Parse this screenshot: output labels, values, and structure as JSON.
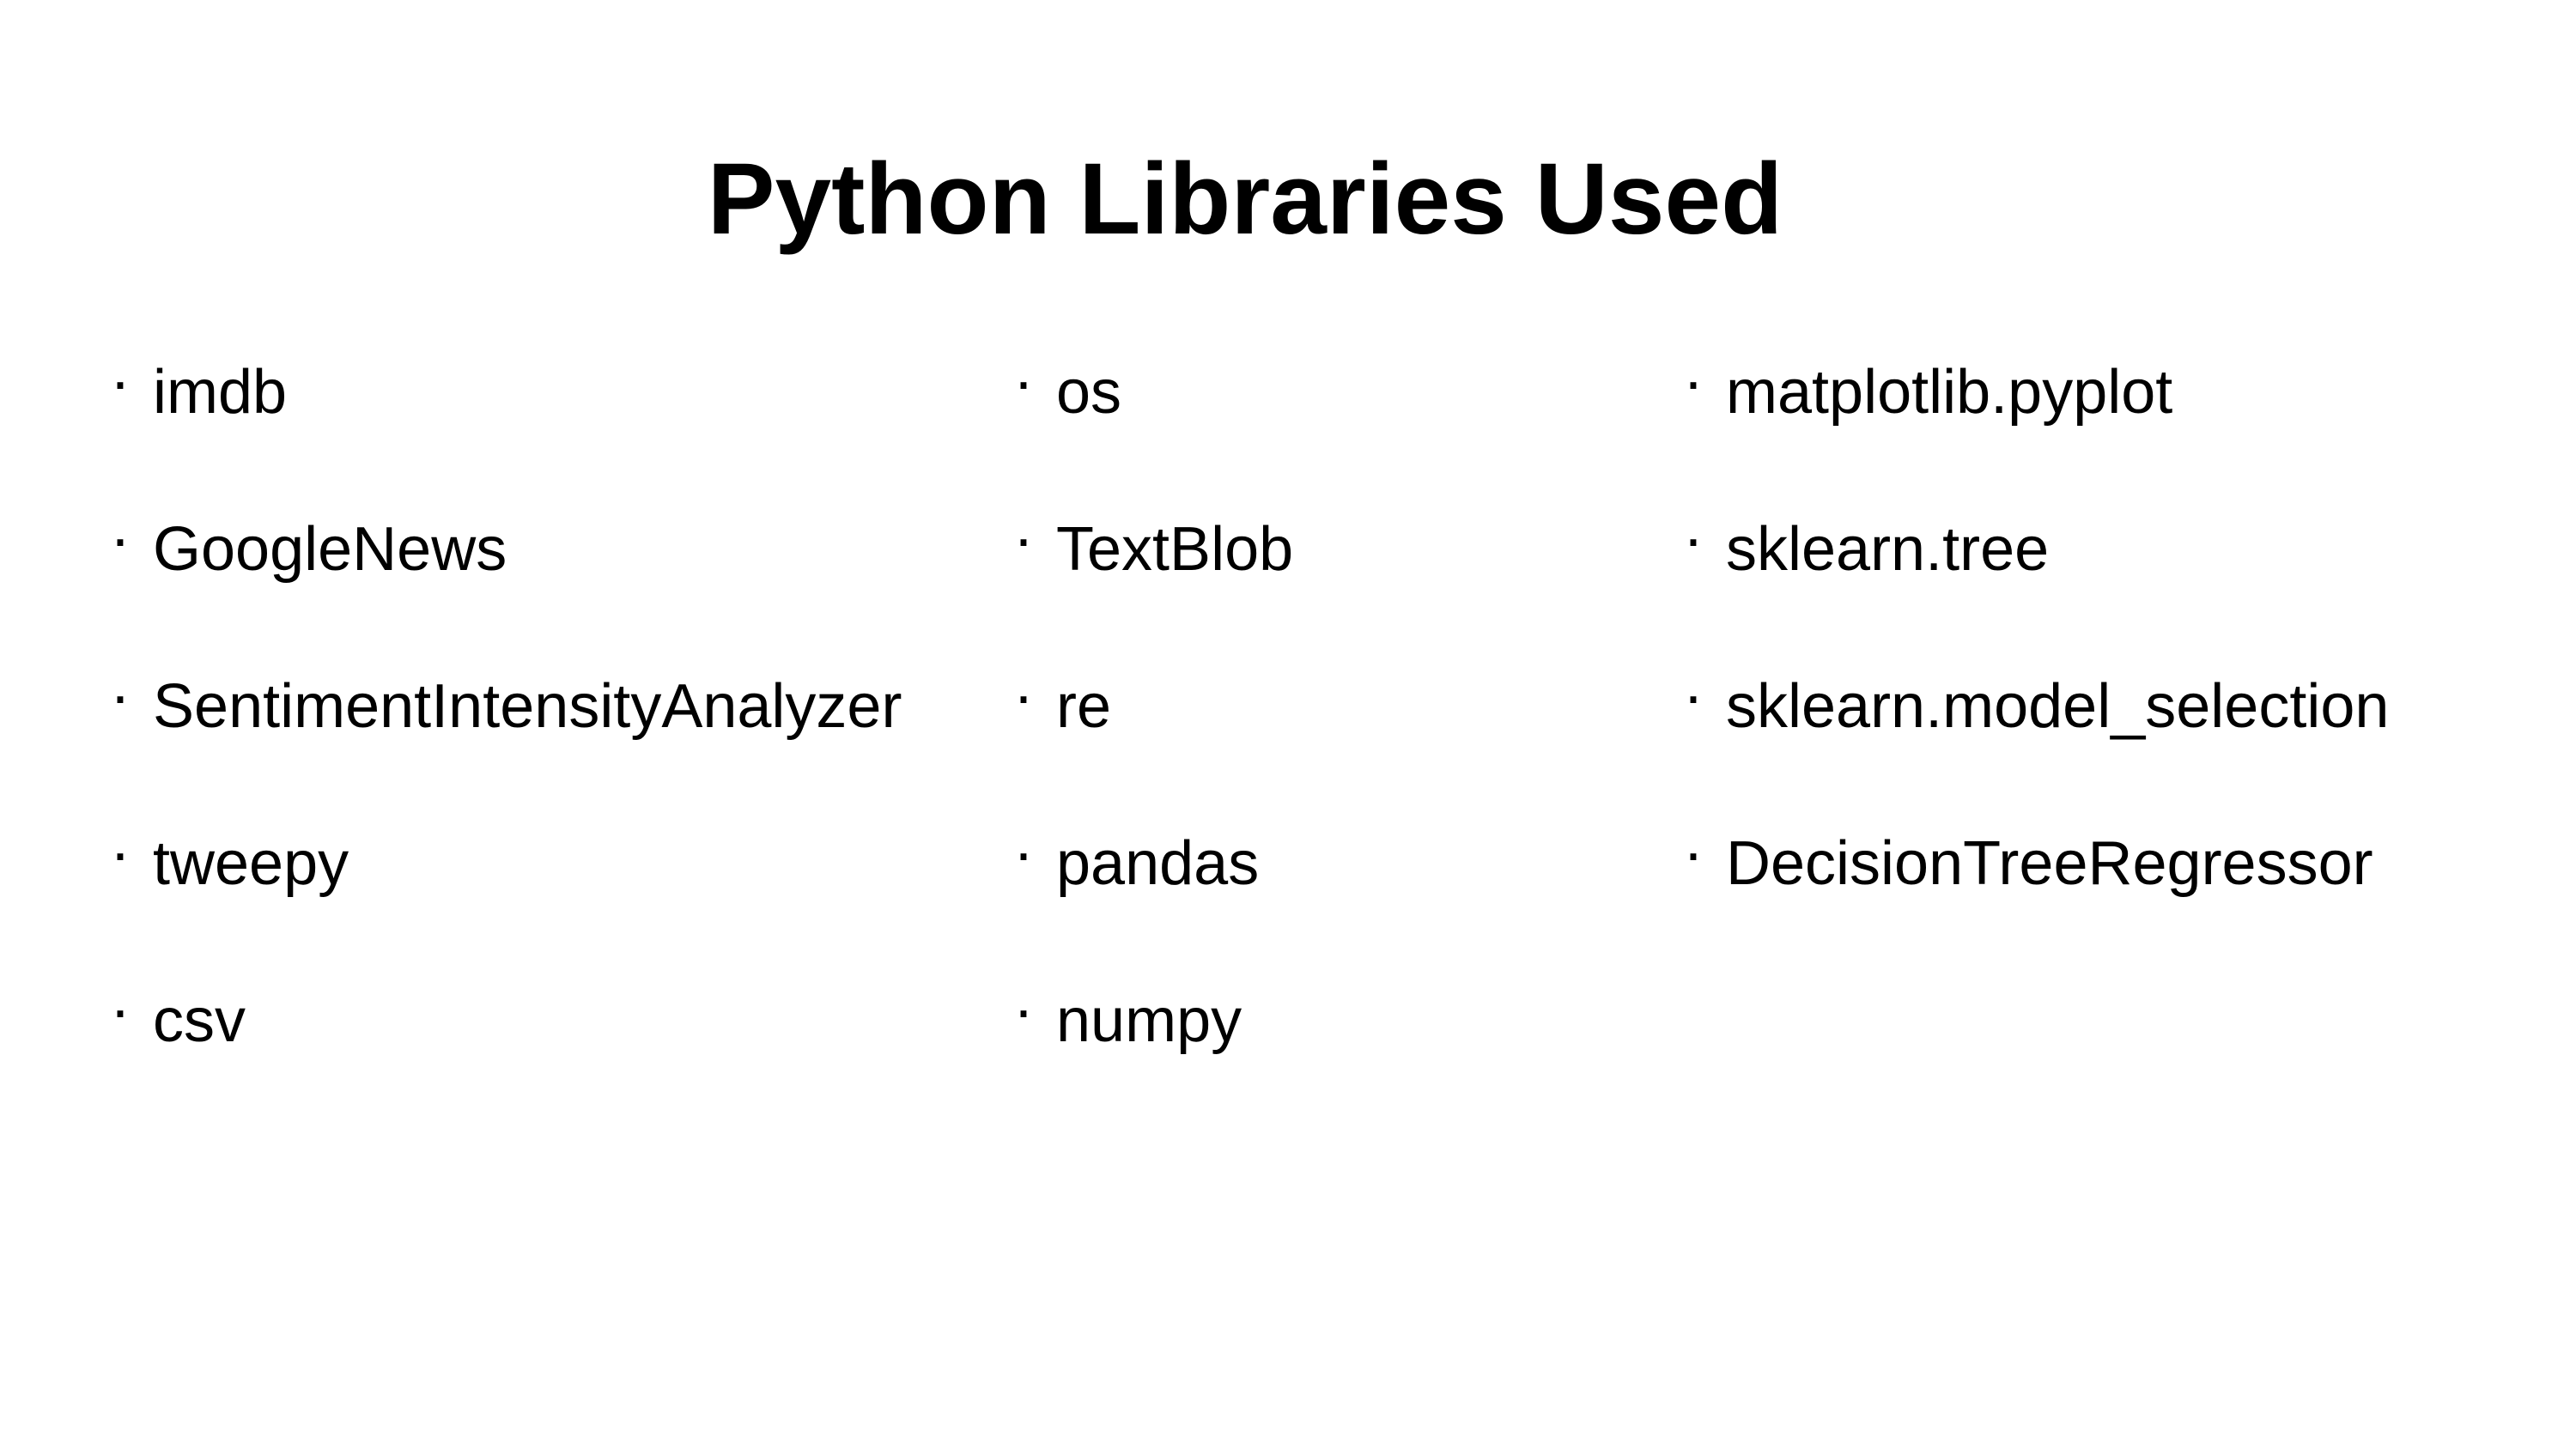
{
  "slide": {
    "title": "Python Libraries Used",
    "bullet_char": "·",
    "columns": [
      {
        "items": [
          "imdb",
          "GoogleNews",
          "SentimentIntensityAnalyzer",
          "tweepy",
          "csv"
        ]
      },
      {
        "items": [
          "os",
          "TextBlob",
          "re",
          "pandas",
          "numpy"
        ]
      },
      {
        "items": [
          "matplotlib.pyplot",
          "sklearn.tree",
          "sklearn.model_selection",
          "DecisionTreeRegressor"
        ]
      }
    ]
  }
}
